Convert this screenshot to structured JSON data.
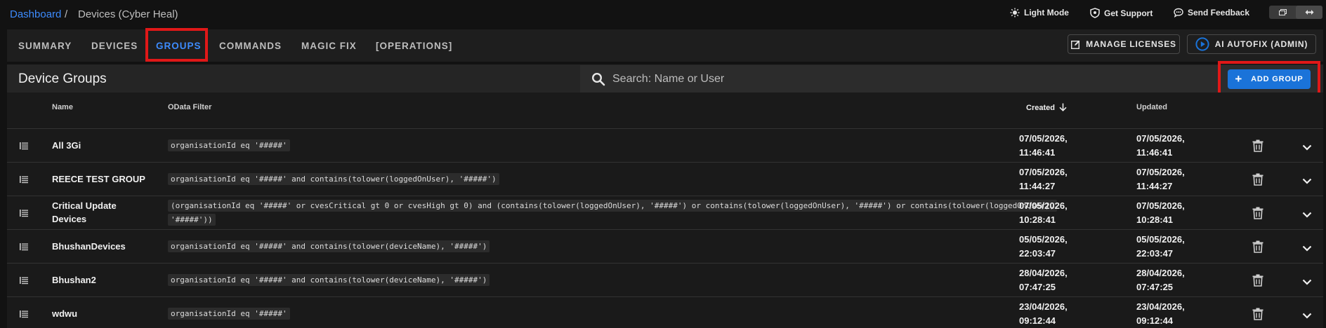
{
  "breadcrumb": {
    "root": "Dashboard",
    "separator": "/",
    "current": "Devices (Cyber Heal)"
  },
  "top_actions": {
    "light_mode": "Light Mode",
    "get_support": "Get Support",
    "send_feedback": "Send Feedback"
  },
  "tabs": [
    {
      "label": "SUMMARY"
    },
    {
      "label": "DEVICES"
    },
    {
      "label": "GROUPS",
      "active": true
    },
    {
      "label": "COMMANDS"
    },
    {
      "label": "MAGIC FIX"
    },
    {
      "label": "[OPERATIONS]"
    }
  ],
  "header_buttons": {
    "manage_licenses": "MANAGE LICENSES",
    "ai_autofix": "AI AUTOFIX (ADMIN)"
  },
  "panel": {
    "title": "Device Groups",
    "search_placeholder": "Search: Name or User",
    "add_group": "ADD GROUP"
  },
  "table": {
    "columns": {
      "name": "Name",
      "filter": "OData Filter",
      "created": "Created",
      "updated": "Updated"
    },
    "rows": [
      {
        "name": [
          "All 3Gi"
        ],
        "filter": [
          "organisationId eq '#####'"
        ],
        "created": [
          "07/05/2026,",
          "11:46:41"
        ],
        "updated": [
          "07/05/2026,",
          "11:46:41"
        ]
      },
      {
        "name": [
          "REECE TEST GROUP"
        ],
        "filter": [
          "organisationId eq '#####' and contains(tolower(loggedOnUser), '#####')"
        ],
        "created": [
          "07/05/2026,",
          "11:44:27"
        ],
        "updated": [
          "07/05/2026,",
          "11:44:27"
        ]
      },
      {
        "name": [
          "Critical Update",
          "Devices"
        ],
        "filter": [
          "(organisationId eq '#####' or cvesCritical gt 0 or cvesHigh gt 0) and (contains(tolower(loggedOnUser), '#####') or contains(tolower(loggedOnUser), '#####') or contains(tolower(loggedOnUser),",
          "'#####'))"
        ],
        "created": [
          "07/05/2026,",
          "10:28:41"
        ],
        "updated": [
          "07/05/2026,",
          "10:28:41"
        ]
      },
      {
        "name": [
          "BhushanDevices"
        ],
        "filter": [
          "organisationId eq '#####' and contains(tolower(deviceName), '#####')"
        ],
        "created": [
          "05/05/2026,",
          "22:03:47"
        ],
        "updated": [
          "05/05/2026,",
          "22:03:47"
        ]
      },
      {
        "name": [
          "Bhushan2"
        ],
        "filter": [
          "organisationId eq '#####' and contains(tolower(deviceName), '#####')"
        ],
        "created": [
          "28/04/2026,",
          "07:47:25"
        ],
        "updated": [
          "28/04/2026,",
          "07:47:25"
        ]
      },
      {
        "name": [
          "wdwu"
        ],
        "filter": [
          "organisationId eq '#####'"
        ],
        "created": [
          "23/04/2026,",
          "09:12:44"
        ],
        "updated": [
          "23/04/2026,",
          "09:12:44"
        ]
      }
    ]
  },
  "colors": {
    "accent": "#3d8bfd",
    "highlight": "#e01818",
    "primary_button": "#1a73d9"
  }
}
